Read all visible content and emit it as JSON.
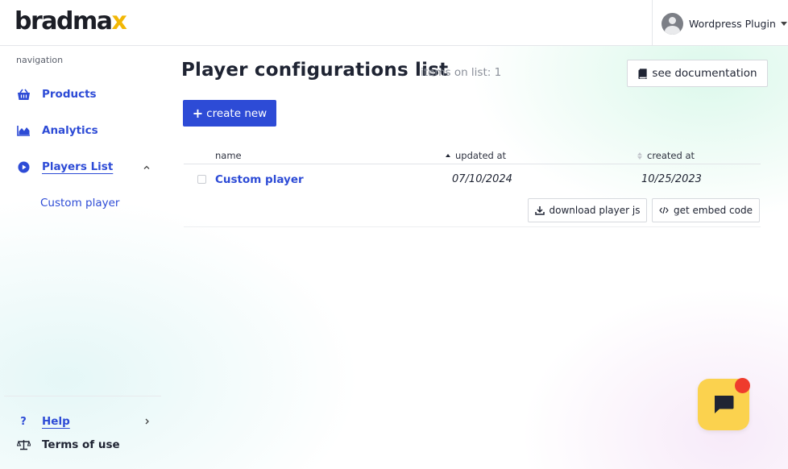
{
  "header": {
    "logo_main": "bradma",
    "logo_x": "x",
    "user_menu_label": "Wordpress Plugin"
  },
  "sidebar": {
    "caption": "navigation",
    "items": [
      {
        "label": "Products",
        "icon": "basket-icon"
      },
      {
        "label": "Analytics",
        "icon": "area-chart-icon"
      },
      {
        "label": "Players List",
        "icon": "play-circle-icon",
        "expanded": true
      }
    ],
    "sub_items": [
      {
        "label": "Custom player"
      }
    ],
    "footer": [
      {
        "label": "Help",
        "icon": "question-icon"
      },
      {
        "label": "Terms of use",
        "icon": "scales-icon"
      }
    ]
  },
  "main": {
    "title": "Player configurations list",
    "items_count": "items on list: 1",
    "doc_button": "see documentation",
    "create_button": "create new",
    "table": {
      "columns": [
        "name",
        "updated at",
        "created at"
      ],
      "rows": [
        {
          "name": "Custom player",
          "updated_at": "07/10/2024",
          "created_at": "10/25/2023"
        }
      ]
    },
    "row_actions": {
      "download": "download player js",
      "embed": "get embed code"
    }
  },
  "colors": {
    "accent": "#2d4bd6",
    "brand_yellow": "#f2b705",
    "chat_bubble": "#fbd24e",
    "notification": "#ef3b2d"
  }
}
